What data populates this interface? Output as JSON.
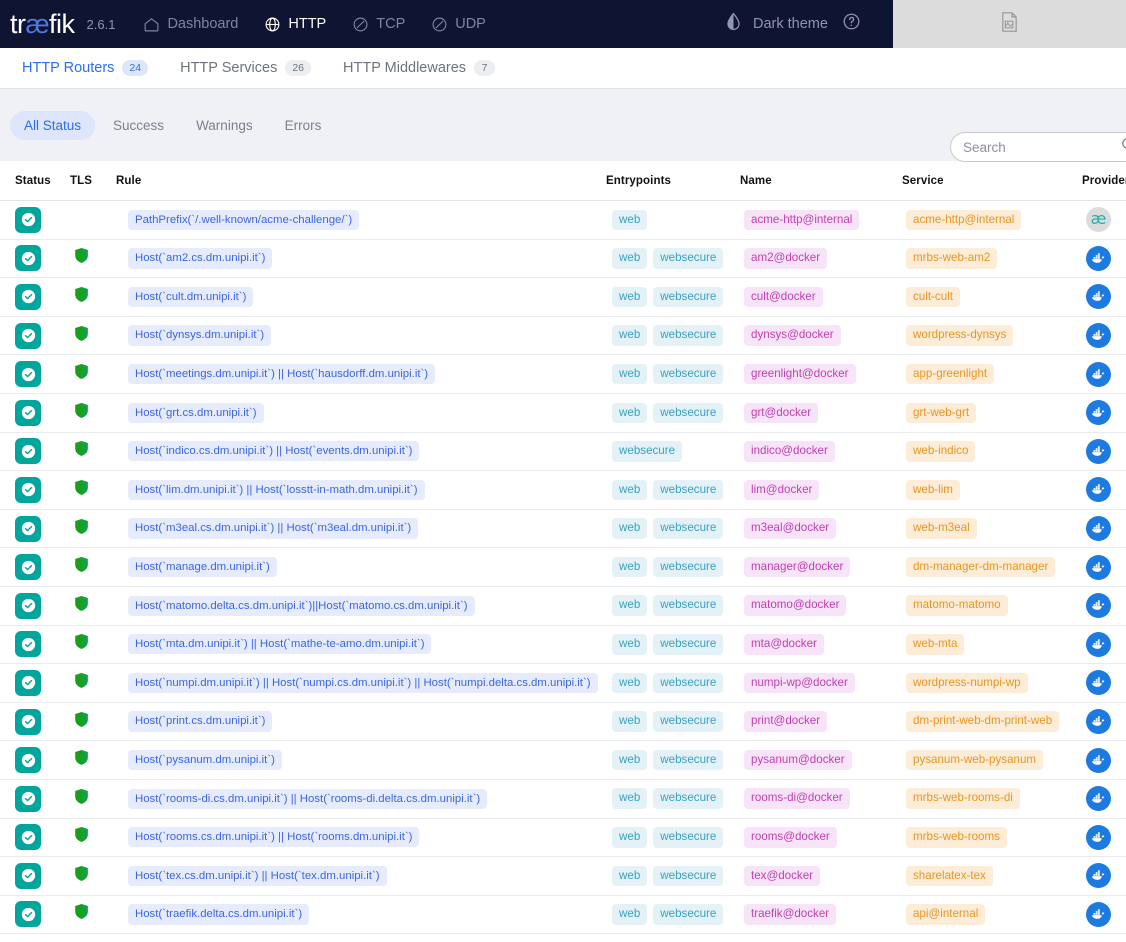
{
  "header": {
    "brand_prefix": "tr",
    "brand_ae": "æ",
    "brand_suffix": "fik",
    "version": "2.6.1",
    "nav": [
      {
        "label": "Dashboard",
        "icon": "home-icon",
        "active": false
      },
      {
        "label": "HTTP",
        "icon": "globe-icon",
        "active": true
      },
      {
        "label": "TCP",
        "icon": "tcp-icon",
        "active": false
      },
      {
        "label": "UDP",
        "icon": "udp-icon",
        "active": false
      }
    ],
    "theme_label": "Dark theme",
    "theme_icon": "contrast-drop-icon",
    "help_icon": "question-circle-icon",
    "panel_icon": "broken-image-icon"
  },
  "tabs": [
    {
      "label": "HTTP Routers",
      "count": "24",
      "active": true
    },
    {
      "label": "HTTP Services",
      "count": "26",
      "active": false
    },
    {
      "label": "HTTP Middlewares",
      "count": "7",
      "active": false
    }
  ],
  "filters": [
    {
      "label": "All Status",
      "active": true
    },
    {
      "label": "Success",
      "active": false
    },
    {
      "label": "Warnings",
      "active": false
    },
    {
      "label": "Errors",
      "active": false
    }
  ],
  "search": {
    "value": "",
    "placeholder": "Search",
    "icon": "search-icon"
  },
  "table": {
    "columns": [
      "Status",
      "TLS",
      "Rule",
      "Entrypoints",
      "Name",
      "Service",
      "Provider"
    ],
    "rows": [
      {
        "status": "success",
        "tls": false,
        "rule": "PathPrefix(`/.well-known/acme-challenge/`)",
        "entrypoints": [
          "web"
        ],
        "name": "acme-http@internal",
        "service": "acme-http@internal",
        "provider": "internal"
      },
      {
        "status": "success",
        "tls": true,
        "rule": "Host(`am2.cs.dm.unipi.it`)",
        "entrypoints": [
          "web",
          "websecure"
        ],
        "name": "am2@docker",
        "service": "mrbs-web-am2",
        "provider": "docker"
      },
      {
        "status": "success",
        "tls": true,
        "rule": "Host(`cult.dm.unipi.it`)",
        "entrypoints": [
          "web",
          "websecure"
        ],
        "name": "cult@docker",
        "service": "cult-cult",
        "provider": "docker"
      },
      {
        "status": "success",
        "tls": true,
        "rule": "Host(`dynsys.dm.unipi.it`)",
        "entrypoints": [
          "web",
          "websecure"
        ],
        "name": "dynsys@docker",
        "service": "wordpress-dynsys",
        "provider": "docker"
      },
      {
        "status": "success",
        "tls": true,
        "rule": "Host(`meetings.dm.unipi.it`) || Host(`hausdorff.dm.unipi.it`)",
        "entrypoints": [
          "web",
          "websecure"
        ],
        "name": "greenlight@docker",
        "service": "app-greenlight",
        "provider": "docker"
      },
      {
        "status": "success",
        "tls": true,
        "rule": "Host(`grt.cs.dm.unipi.it`)",
        "entrypoints": [
          "web",
          "websecure"
        ],
        "name": "grt@docker",
        "service": "grt-web-grt",
        "provider": "docker"
      },
      {
        "status": "success",
        "tls": true,
        "rule": "Host(`indico.cs.dm.unipi.it`) || Host(`events.dm.unipi.it`)",
        "entrypoints": [
          "websecure"
        ],
        "name": "indico@docker",
        "service": "web-indico",
        "provider": "docker"
      },
      {
        "status": "success",
        "tls": true,
        "rule": "Host(`lim.dm.unipi.it`) || Host(`losstt-in-math.dm.unipi.it`)",
        "entrypoints": [
          "web",
          "websecure"
        ],
        "name": "lim@docker",
        "service": "web-lim",
        "provider": "docker"
      },
      {
        "status": "success",
        "tls": true,
        "rule": "Host(`m3eal.cs.dm.unipi.it`) || Host(`m3eal.dm.unipi.it`)",
        "entrypoints": [
          "web",
          "websecure"
        ],
        "name": "m3eal@docker",
        "service": "web-m3eal",
        "provider": "docker"
      },
      {
        "status": "success",
        "tls": true,
        "rule": "Host(`manage.dm.unipi.it`)",
        "entrypoints": [
          "web",
          "websecure"
        ],
        "name": "manager@docker",
        "service": "dm-manager-dm-manager",
        "provider": "docker"
      },
      {
        "status": "success",
        "tls": true,
        "rule": "Host(`matomo.delta.cs.dm.unipi.it`)||Host(`matomo.cs.dm.unipi.it`)",
        "entrypoints": [
          "web",
          "websecure"
        ],
        "name": "matomo@docker",
        "service": "matomo-matomo",
        "provider": "docker"
      },
      {
        "status": "success",
        "tls": true,
        "rule": "Host(`mta.dm.unipi.it`) || Host(`mathe-te-amo.dm.unipi.it`)",
        "entrypoints": [
          "web",
          "websecure"
        ],
        "name": "mta@docker",
        "service": "web-mta",
        "provider": "docker"
      },
      {
        "status": "success",
        "tls": true,
        "rule": "Host(`numpi.dm.unipi.it`) || Host(`numpi.cs.dm.unipi.it`) || Host(`numpi.delta.cs.dm.unipi.it`)",
        "entrypoints": [
          "web",
          "websecure"
        ],
        "name": "numpi-wp@docker",
        "service": "wordpress-numpi-wp",
        "provider": "docker"
      },
      {
        "status": "success",
        "tls": true,
        "rule": "Host(`print.cs.dm.unipi.it`)",
        "entrypoints": [
          "web",
          "websecure"
        ],
        "name": "print@docker",
        "service": "dm-print-web-dm-print-web",
        "provider": "docker"
      },
      {
        "status": "success",
        "tls": true,
        "rule": "Host(`pysanum.dm.unipi.it`)",
        "entrypoints": [
          "web",
          "websecure"
        ],
        "name": "pysanum@docker",
        "service": "pysanum-web-pysanum",
        "provider": "docker"
      },
      {
        "status": "success",
        "tls": true,
        "rule": "Host(`rooms-di.cs.dm.unipi.it`) || Host(`rooms-di.delta.cs.dm.unipi.it`)",
        "entrypoints": [
          "web",
          "websecure"
        ],
        "name": "rooms-di@docker",
        "service": "mrbs-web-rooms-di",
        "provider": "docker"
      },
      {
        "status": "success",
        "tls": true,
        "rule": "Host(`rooms.cs.dm.unipi.it`) || Host(`rooms.dm.unipi.it`)",
        "entrypoints": [
          "web",
          "websecure"
        ],
        "name": "rooms@docker",
        "service": "mrbs-web-rooms",
        "provider": "docker"
      },
      {
        "status": "success",
        "tls": true,
        "rule": "Host(`tex.cs.dm.unipi.it`) || Host(`tex.dm.unipi.it`)",
        "entrypoints": [
          "web",
          "websecure"
        ],
        "name": "tex@docker",
        "service": "sharelatex-tex",
        "provider": "docker"
      },
      {
        "status": "success",
        "tls": true,
        "rule": "Host(`traefik.delta.cs.dm.unipi.it`)",
        "entrypoints": [
          "web",
          "websecure"
        ],
        "name": "traefik@docker",
        "service": "api@internal",
        "provider": "docker"
      }
    ]
  },
  "colors": {
    "nav_bg": "#0e1431",
    "accent_blue": "#2b6ef5",
    "status_green": "#00a69c",
    "tls_green": "#1aa119",
    "chip_rule": "#3b66e0",
    "chip_entry": "#3aa2c2",
    "chip_name": "#c13fb4",
    "chip_service": "#e8961e",
    "docker_blue": "#1d7ae0"
  }
}
